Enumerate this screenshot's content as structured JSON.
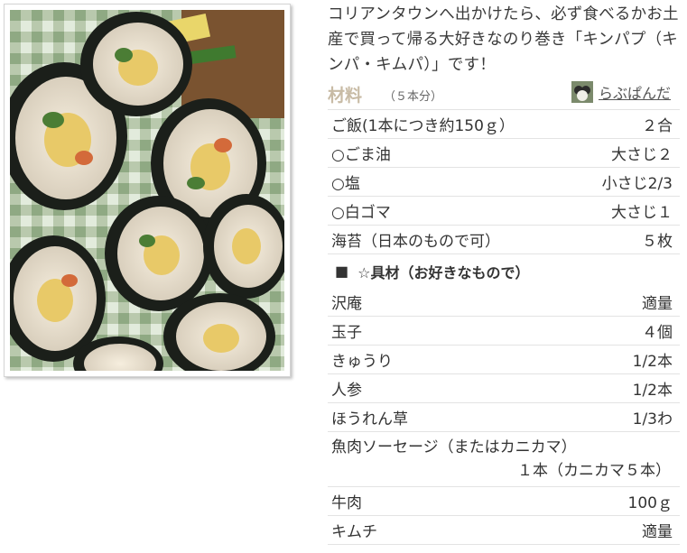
{
  "recipe": {
    "photo_icon": "kimbap-photo",
    "intro": "コリアンタウンへ出かけたら、必ず食べるかお土産で買って帰る大好きなのり巻き「キンパプ（キンパ・キムパ）」です！"
  },
  "materials": {
    "title": "材料",
    "servings": "（５本分）",
    "author_name": "らぶぱんだ",
    "author_icon": "author-avatar"
  },
  "ingredients": [
    {
      "name": "ご飯(1本につき約150ｇ）",
      "amount": "２合"
    },
    {
      "name": "○ごま油",
      "amount": "大さじ２"
    },
    {
      "name": "○塩",
      "amount": "小さじ2/3"
    },
    {
      "name": "○白ゴマ",
      "amount": "大さじ１"
    },
    {
      "name": "海苔（日本のもので可）",
      "amount": "５枚"
    }
  ],
  "fillings_section": {
    "marker": "■",
    "title": "☆具材（お好きなもので）"
  },
  "fillings": [
    {
      "name": "沢庵",
      "amount": "適量"
    },
    {
      "name": "玉子",
      "amount": "４個"
    },
    {
      "name": "きゅうり",
      "amount": "1/2本"
    },
    {
      "name": "人参",
      "amount": "1/2本"
    },
    {
      "name": "ほうれん草",
      "amount": "1/3わ"
    }
  ],
  "sausage": {
    "name": "魚肉ソーセージ（またはカニカマ）",
    "amount": "１本（カニカマ５本）"
  },
  "fillings_after": [
    {
      "name": "牛肉",
      "amount": "100ｇ"
    },
    {
      "name": "キムチ",
      "amount": "適量"
    }
  ]
}
